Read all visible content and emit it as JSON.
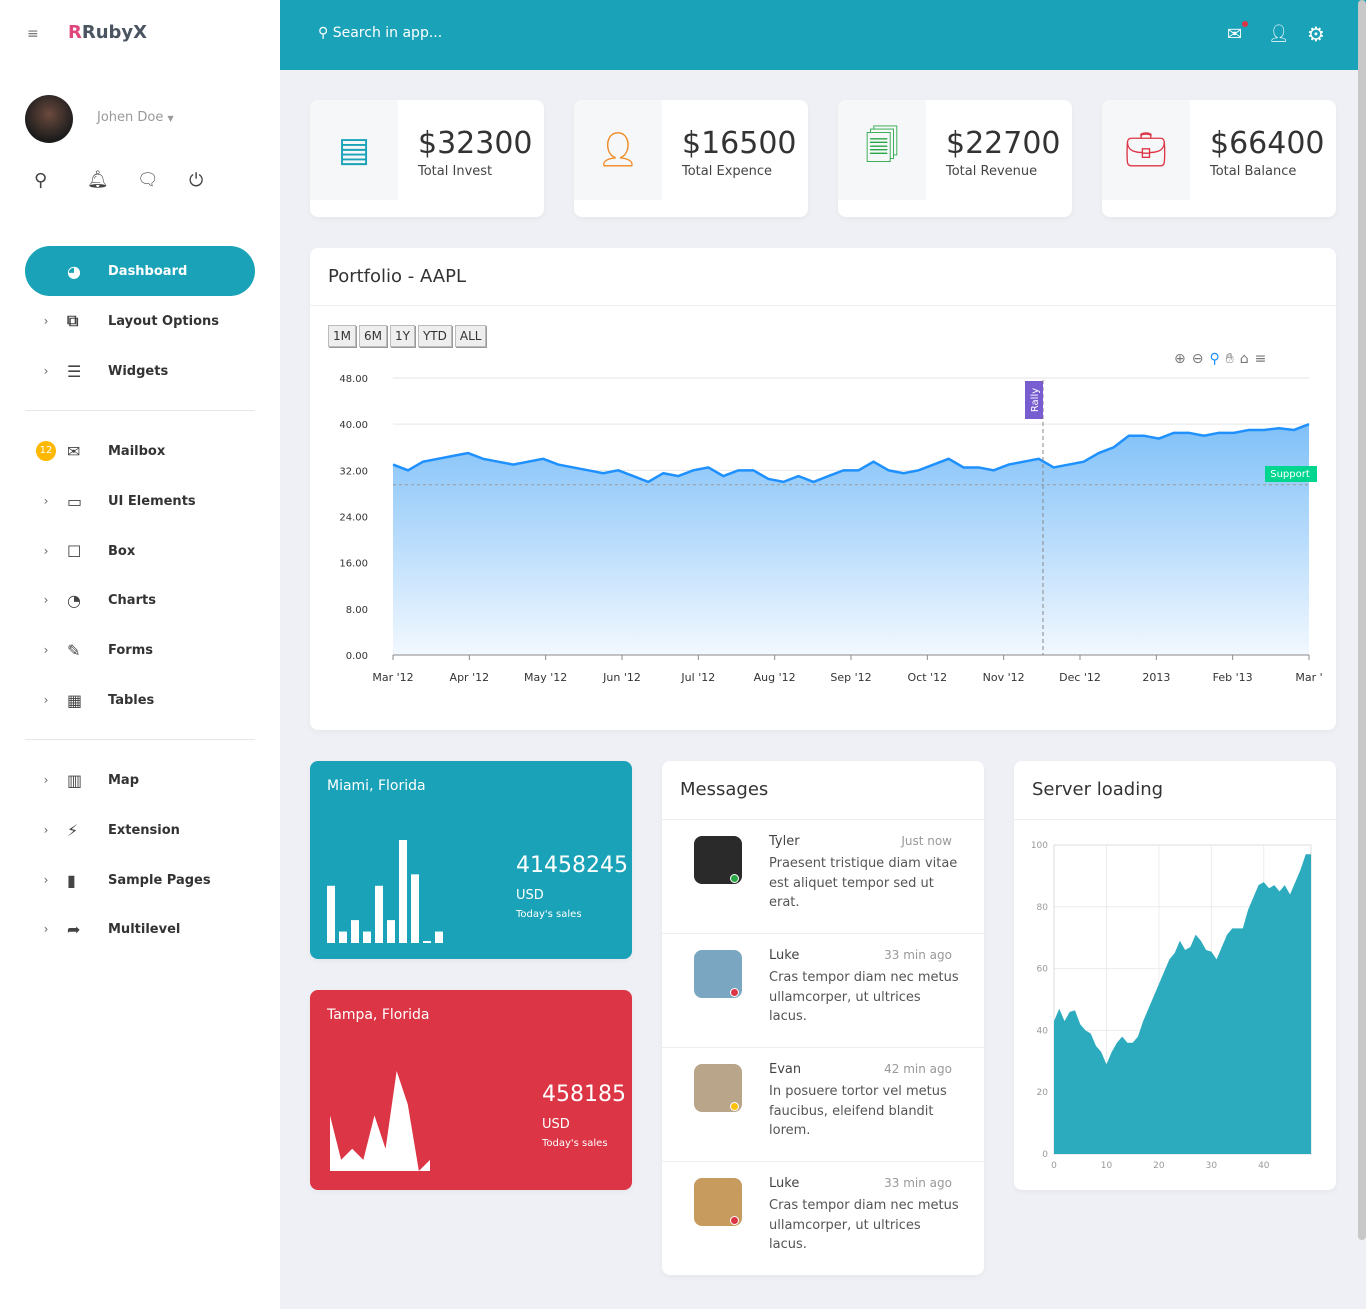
{
  "brand": {
    "name": "RubyX"
  },
  "user": {
    "name": "Johen Doe"
  },
  "sidebar": {
    "items": [
      {
        "label": "Dashboard",
        "icon": "dashboard-icon"
      },
      {
        "label": "Layout Options",
        "icon": "layout-icon"
      },
      {
        "label": "Widgets",
        "icon": "widgets-icon"
      },
      {
        "label": "Mailbox",
        "icon": "mail-icon",
        "badge": "12"
      },
      {
        "label": "UI Elements",
        "icon": "laptop-icon"
      },
      {
        "label": "Box",
        "icon": "box-icon"
      },
      {
        "label": "Charts",
        "icon": "pie-chart-icon"
      },
      {
        "label": "Forms",
        "icon": "edit-icon"
      },
      {
        "label": "Tables",
        "icon": "table-icon"
      },
      {
        "label": "Map",
        "icon": "map-icon"
      },
      {
        "label": "Extension",
        "icon": "plug-icon"
      },
      {
        "label": "Sample Pages",
        "icon": "file-icon"
      },
      {
        "label": "Multilevel",
        "icon": "share-icon"
      }
    ]
  },
  "header": {
    "search_placeholder": "Search in app..."
  },
  "colors": {
    "accent": "#1aa3b8",
    "danger": "#dc3545",
    "chart_line": "#1e90ff"
  },
  "stats": [
    {
      "value": "$32300",
      "label": "Total Invest",
      "color": "#1aa3b8"
    },
    {
      "value": "$16500",
      "label": "Total Expence",
      "color": "#f08a24"
    },
    {
      "value": "$22700",
      "label": "Total Revenue",
      "color": "#28a745"
    },
    {
      "value": "$66400",
      "label": "Total Balance",
      "color": "#dc3545"
    }
  ],
  "portfolio": {
    "title": "Portfolio - AAPL",
    "ranges": [
      "1M",
      "6M",
      "1Y",
      "YTD",
      "ALL"
    ]
  },
  "chart_data": [
    {
      "type": "area",
      "title": "Portfolio - AAPL",
      "ylim": [
        0,
        48
      ],
      "yticks": [
        "0.00",
        "8.00",
        "16.00",
        "24.00",
        "32.00",
        "40.00",
        "48.00"
      ],
      "xticks": [
        "Mar '12",
        "Apr '12",
        "May '12",
        "Jun '12",
        "Jul '12",
        "Aug '12",
        "Sep '12",
        "Oct '12",
        "Nov '12",
        "Dec '12",
        "2013",
        "Feb '13",
        "Mar '"
      ],
      "values": [
        33,
        32,
        33.5,
        34,
        34.5,
        35,
        34,
        33.5,
        33,
        33.5,
        34,
        33,
        32.5,
        32,
        31.5,
        32,
        31,
        30,
        31.5,
        31,
        32,
        32.5,
        31,
        32,
        32,
        30.5,
        30,
        31,
        30,
        31,
        32,
        32,
        33.5,
        32,
        31.5,
        32,
        33,
        34,
        32.5,
        32.5,
        32,
        33,
        33.5,
        34,
        32.5,
        33,
        33.5,
        35,
        36,
        38,
        38,
        37.5,
        38.5,
        38.5,
        38,
        38.5,
        38.5,
        39,
        39,
        39.3,
        39,
        40
      ],
      "annotations": {
        "x_label": "Rally",
        "y_label": "Support",
        "y_value": 29.5
      }
    },
    {
      "type": "bar",
      "title": "Miami, Florida",
      "values": [
        5,
        1,
        2,
        1,
        5,
        2,
        9,
        6,
        0,
        1
      ]
    },
    {
      "type": "area",
      "title": "Tampa, Florida",
      "values": [
        5,
        1,
        2,
        1,
        5,
        2,
        9,
        6,
        0,
        1
      ]
    },
    {
      "type": "area",
      "title": "Server loading",
      "xlim": [
        0,
        49
      ],
      "ylim": [
        0,
        100
      ],
      "xticks": [
        "0",
        "10",
        "20",
        "30",
        "40"
      ],
      "yticks": [
        "0",
        "20",
        "40",
        "60",
        "80",
        "100"
      ],
      "values": [
        43,
        47,
        43,
        46,
        46.5,
        42,
        40,
        39,
        35,
        33,
        29,
        33,
        36,
        38,
        36,
        36,
        38,
        43,
        47,
        51,
        55,
        59,
        63,
        65,
        69,
        66,
        67,
        71,
        69,
        66,
        65.5,
        63,
        67,
        71,
        73,
        73,
        73,
        79,
        83,
        87,
        88,
        86,
        87,
        85,
        87,
        84,
        88,
        92,
        97,
        97
      ]
    }
  ],
  "miami": {
    "title": "Miami, Florida",
    "value": "41458245",
    "currency": "USD",
    "caption": "Today's sales"
  },
  "tampa": {
    "title": "Tampa, Florida",
    "value": "458185",
    "currency": "USD",
    "caption": "Today's sales"
  },
  "messages": {
    "title": "Messages",
    "items": [
      {
        "name": "Tyler",
        "time": "Just now",
        "text": "Praesent tristique diam vitae est aliquet tempor sed ut erat.",
        "status": "#28a745"
      },
      {
        "name": "Luke",
        "time": "33 min ago",
        "text": "Cras tempor diam nec metus ullamcorper, ut ultrices lacus.",
        "status": "#dc3545"
      },
      {
        "name": "Evan",
        "time": "42 min ago",
        "text": "In posuere tortor vel metus faucibus, eleifend blandit lorem.",
        "status": "#ffc107"
      },
      {
        "name": "Luke",
        "time": "33 min ago",
        "text": "Cras tempor diam nec metus ullamcorper, ut ultrices lacus.",
        "status": "#dc3545"
      }
    ]
  },
  "server": {
    "title": "Server loading"
  }
}
